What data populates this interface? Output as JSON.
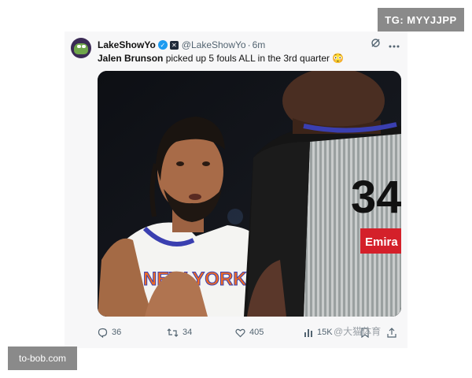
{
  "badges": {
    "top_right": "TG: MYYJJPP",
    "bottom_left": "to-bob.com"
  },
  "tweet": {
    "display_name": "LakeShowYo",
    "handle": "@LakeShowYo",
    "separator": "·",
    "time": "6m",
    "text_bold": "Jalen Brunson",
    "text_rest": " picked up 5 fouls ALL in the 3rd quarter 😳",
    "image": {
      "jersey_text": "NEW YORK",
      "referee_number": "34",
      "referee_patch": "Emira"
    },
    "actions": {
      "replies": "36",
      "reposts": "34",
      "likes": "405",
      "views": "15K"
    },
    "watermark": "@大猫体育"
  },
  "colors": {
    "verified": "#1d9bf0",
    "secondary_text": "#536471",
    "badge_bg": "#8a8a8a",
    "knicks_orange": "#f26b21",
    "knicks_blue": "#3a3fb0"
  }
}
